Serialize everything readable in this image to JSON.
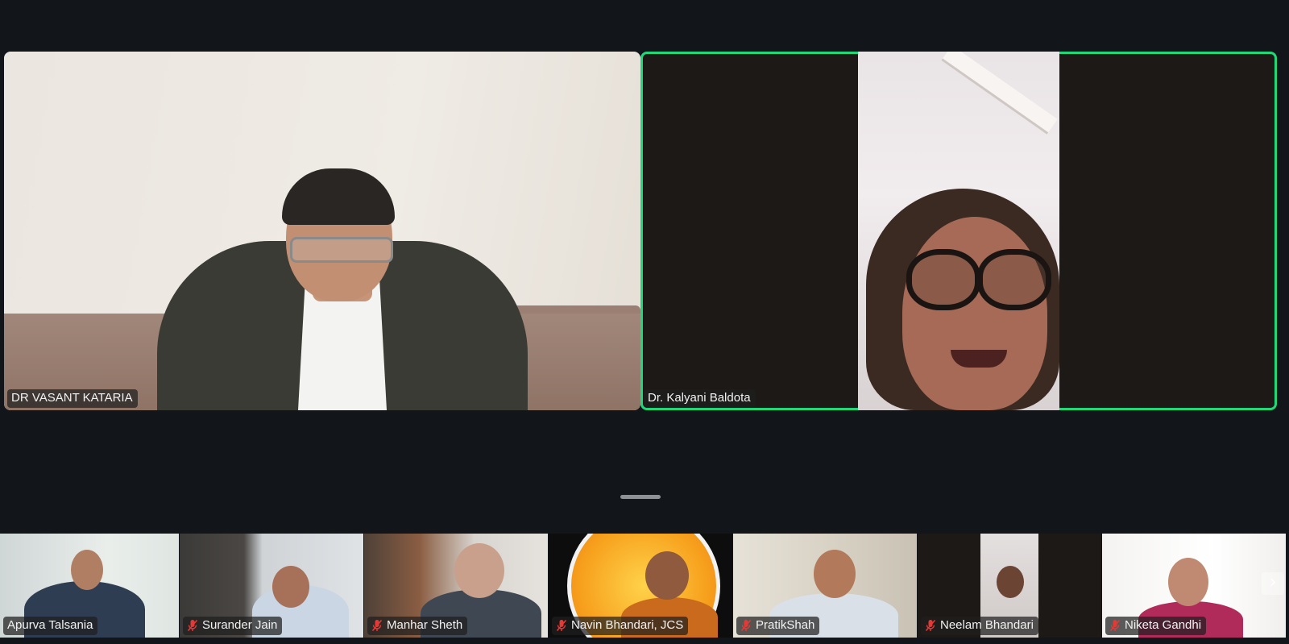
{
  "main_speakers": [
    {
      "name": "DR VASANT KATARIA",
      "active": false
    },
    {
      "name": "Dr. Kalyani Baldota",
      "active": true
    }
  ],
  "participants_strip": [
    {
      "name": "Apurva Talsania",
      "muted": false
    },
    {
      "name": "Surander Jain",
      "muted": true
    },
    {
      "name": "Manhar Sheth",
      "muted": true
    },
    {
      "name": "Navin Bhandari, JCS",
      "muted": true
    },
    {
      "name": "PratikShah",
      "muted": true
    },
    {
      "name": "Neelam Bhandari",
      "muted": true
    },
    {
      "name": "Niketa Gandhi",
      "muted": true
    }
  ],
  "colors": {
    "background": "#12161a",
    "active_speaker_border": "#1ed97a",
    "muted_mic": "#e53935"
  },
  "icons": {
    "muted": "mic-off-icon",
    "next_page": "chevron-right-icon"
  },
  "next_page_glyph": "›"
}
